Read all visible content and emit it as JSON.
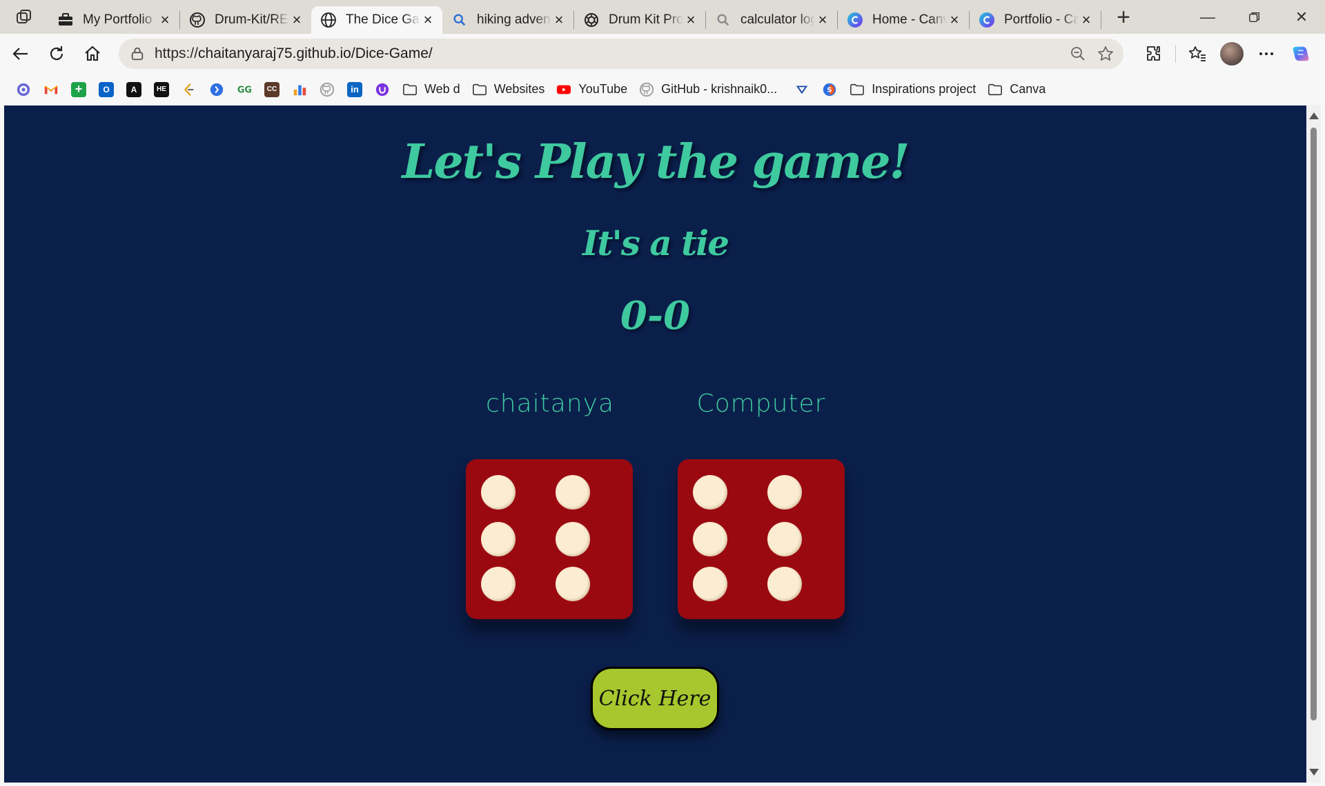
{
  "browser": {
    "tabs": [
      {
        "label": "My Portfolio",
        "icon": "briefcase-icon",
        "active": false
      },
      {
        "label": "Drum-Kit/README",
        "icon": "github-icon",
        "active": false
      },
      {
        "label": "The Dice Game",
        "icon": "globe-icon",
        "active": true
      },
      {
        "label": "hiking adventure",
        "icon": "search-icon",
        "active": false
      },
      {
        "label": "Drum Kit Project",
        "icon": "openai-icon",
        "active": false
      },
      {
        "label": "calculator logic",
        "icon": "search-icon",
        "active": false
      },
      {
        "label": "Home - Canva",
        "icon": "canva-icon",
        "active": false
      },
      {
        "label": "Portfolio - Canva",
        "icon": "canva-icon",
        "active": false
      }
    ],
    "address": {
      "scheme": "https://",
      "host": "chaitanyaraj75.github.io",
      "path": "/Dice-Game/"
    },
    "bookmarks": [
      {
        "label": "",
        "icon": "app-icon"
      },
      {
        "label": "",
        "icon": "gmail-icon"
      },
      {
        "label": "",
        "icon": "plus-app-icon"
      },
      {
        "label": "",
        "icon": "outlook-icon"
      },
      {
        "label": "",
        "icon": "ai-icon"
      },
      {
        "label": "",
        "icon": "hackerearth-icon"
      },
      {
        "label": "",
        "icon": "leetcode-icon"
      },
      {
        "label": "",
        "icon": "codeforces-icon"
      },
      {
        "label": "",
        "icon": "geeksforgeeks-icon"
      },
      {
        "label": "",
        "icon": "codechef-icon"
      },
      {
        "label": "",
        "icon": "chart-icon"
      },
      {
        "label": "",
        "icon": "github-icon"
      },
      {
        "label": "",
        "icon": "linkedin-icon"
      },
      {
        "label": "",
        "icon": "unstop-icon"
      },
      {
        "label": "Web d",
        "icon": "folder-icon"
      },
      {
        "label": "Websites",
        "icon": "folder-icon"
      },
      {
        "label": "YouTube",
        "icon": "youtube-icon"
      },
      {
        "label": "GitHub - krishnaik0...",
        "icon": "github-icon"
      },
      {
        "label": "",
        "icon": "vpn-icon"
      },
      {
        "label": "",
        "icon": "app-icon"
      },
      {
        "label": "Inspirations project",
        "icon": "folder-icon"
      },
      {
        "label": "Canva",
        "icon": "folder-icon"
      }
    ]
  },
  "game": {
    "title": "Let's Play the game!",
    "result": "It's a tie",
    "score": "0-0",
    "player1": {
      "name": "chaitanya",
      "die_value": 6
    },
    "player2": {
      "name": "Computer",
      "die_value": 6
    },
    "button_label": "Click Here",
    "colors": {
      "background": "#0b1f4b",
      "accent": "#3ec99f",
      "die": "#9b0910",
      "pip": "#fbecd2",
      "button": "#a6c72d"
    }
  }
}
